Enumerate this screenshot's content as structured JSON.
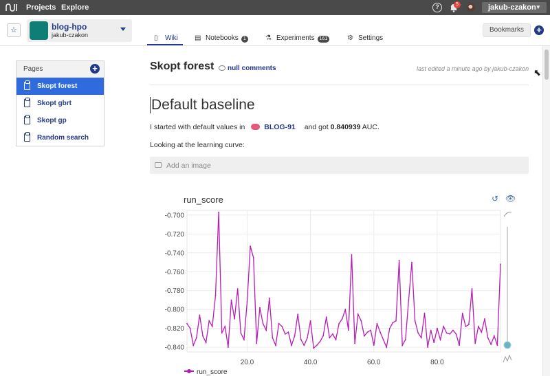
{
  "topbar": {
    "nav": [
      "Projects",
      "Explore"
    ],
    "help_glyph": "?",
    "notification_count": "5",
    "user": "jakub-czakon",
    "icons": [
      "logo-wave-icon",
      "help-icon",
      "bell-icon",
      "avatar",
      "chevron-down-icon"
    ]
  },
  "project": {
    "name": "blog-hpo",
    "owner": "jakub-czakon",
    "thumb_color": "#0f7e76"
  },
  "tabs": [
    {
      "label": "Wiki",
      "icon": "clipboard-icon",
      "active": true
    },
    {
      "label": "Notebooks",
      "icon": "notebook-icon",
      "count": "1"
    },
    {
      "label": "Experiments",
      "icon": "flask-icon",
      "count": "161"
    },
    {
      "label": "Settings",
      "icon": "gear-icon"
    }
  ],
  "header_right": {
    "bookmarks_label": "Bookmarks"
  },
  "sidebar": {
    "title": "Pages",
    "items": [
      {
        "label": "Skopt forest",
        "active": true
      },
      {
        "label": "Skopt gbrt"
      },
      {
        "label": "Skopt gp"
      },
      {
        "label": "Random search"
      }
    ]
  },
  "wiki": {
    "title": "Skopt forest",
    "comments": "null comments",
    "last_edited": "last edited a minute ago by jakub-czakon",
    "heading": "Default baseline",
    "para1_before": "I started with default values in",
    "experiment_tag": "BLOG-91",
    "para1_mid": "and got",
    "auc_value": "0.840939",
    "para1_after": "AUC.",
    "para2": "Looking at the learning curve:",
    "add_image": "Add an image"
  },
  "colors": {
    "accent": "#23398a",
    "active_item": "#2f6bdc",
    "series": "#b61cb6"
  },
  "chart_data": {
    "type": "line",
    "title": "run_score",
    "xlabel": "",
    "ylabel": "",
    "xlim": [
      1,
      100
    ],
    "ylim": [
      -0.845,
      -0.695
    ],
    "xticks": [
      "20.0",
      "40.0",
      "60.0",
      "80.0"
    ],
    "yticks": [
      "-0.700",
      "-0.720",
      "-0.740",
      "-0.760",
      "-0.780",
      "-0.800",
      "-0.820",
      "-0.840"
    ],
    "grid": true,
    "legend": "bottom-left",
    "series": [
      {
        "name": "run_score",
        "x": [
          1,
          2,
          3,
          4,
          5,
          6,
          7,
          8,
          9,
          10,
          11,
          12,
          13,
          14,
          15,
          16,
          17,
          18,
          19,
          20,
          21,
          22,
          23,
          24,
          25,
          26,
          27,
          28,
          29,
          30,
          31,
          32,
          33,
          34,
          35,
          36,
          37,
          38,
          39,
          40,
          41,
          42,
          43,
          44,
          45,
          46,
          47,
          48,
          49,
          50,
          51,
          52,
          53,
          54,
          55,
          56,
          57,
          58,
          59,
          60,
          61,
          62,
          63,
          64,
          65,
          66,
          67,
          68,
          69,
          70,
          71,
          72,
          73,
          74,
          75,
          76,
          77,
          78,
          79,
          80,
          81,
          82,
          83,
          84,
          85,
          86,
          87,
          88,
          89,
          90,
          91,
          92,
          93,
          94,
          95,
          96,
          97,
          98,
          99,
          100
        ],
        "values": [
          -0.815,
          -0.82,
          -0.838,
          -0.83,
          -0.806,
          -0.828,
          -0.835,
          -0.812,
          -0.818,
          -0.785,
          -0.697,
          -0.825,
          -0.818,
          -0.84,
          -0.79,
          -0.81,
          -0.778,
          -0.825,
          -0.832,
          -0.792,
          -0.733,
          -0.745,
          -0.836,
          -0.798,
          -0.815,
          -0.822,
          -0.788,
          -0.83,
          -0.838,
          -0.815,
          -0.818,
          -0.826,
          -0.824,
          -0.838,
          -0.828,
          -0.805,
          -0.832,
          -0.838,
          -0.83,
          -0.812,
          -0.841,
          -0.838,
          -0.834,
          -0.828,
          -0.808,
          -0.83,
          -0.826,
          -0.832,
          -0.815,
          -0.81,
          -0.8,
          -0.822,
          -0.742,
          -0.836,
          -0.805,
          -0.812,
          -0.828,
          -0.824,
          -0.822,
          -0.838,
          -0.815,
          -0.824,
          -0.832,
          -0.84,
          -0.82,
          -0.814,
          -0.812,
          -0.748,
          -0.838,
          -0.832,
          -0.79,
          -0.75,
          -0.812,
          -0.825,
          -0.83,
          -0.804,
          -0.84,
          -0.822,
          -0.835,
          -0.82,
          -0.832,
          -0.818,
          -0.825,
          -0.826,
          -0.822,
          -0.826,
          -0.838,
          -0.804,
          -0.818,
          -0.816,
          -0.778,
          -0.836,
          -0.818,
          -0.824,
          -0.81,
          -0.83,
          -0.837,
          -0.828,
          -0.838,
          -0.752
        ]
      }
    ]
  }
}
